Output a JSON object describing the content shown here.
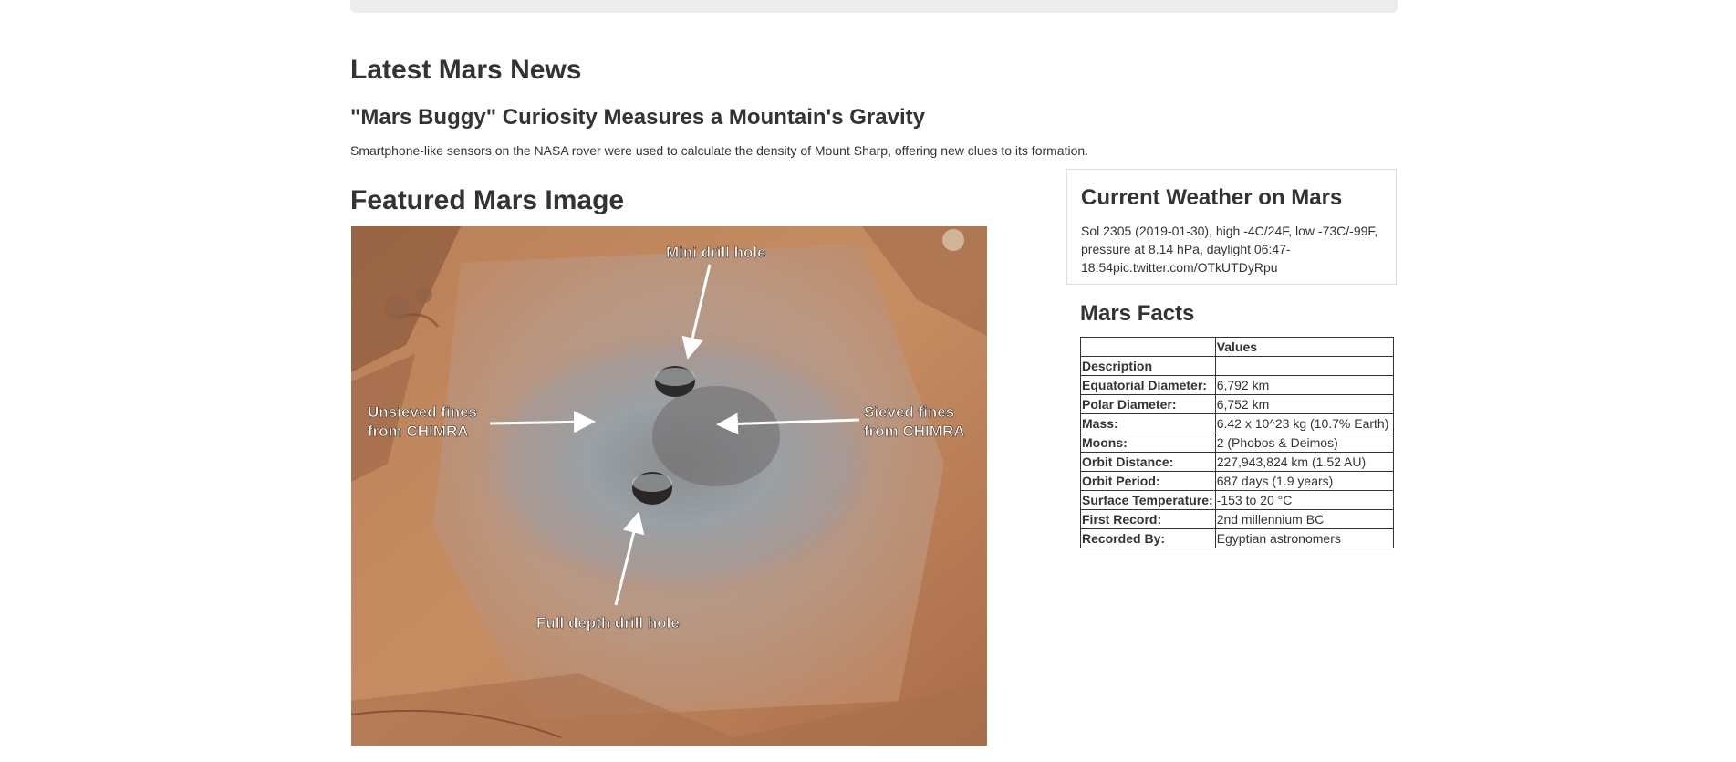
{
  "news": {
    "section_title": "Latest Mars News",
    "title": "\"Mars Buggy\" Curiosity Measures a Mountain's Gravity",
    "paragraph": "Smartphone-like sensors on the NASA rover were used to calculate the density of Mount Sharp, offering new clues to its formation."
  },
  "featured": {
    "title": "Featured Mars Image",
    "labels": {
      "mini_drill": "Mini drill hole",
      "unsieved_line1": "Unsieved fines",
      "unsieved_line2": "from CHIMRA",
      "sieved_line1": "Sieved fines",
      "sieved_line2": "from CHIMRA",
      "full_drill": "Full depth drill hole"
    }
  },
  "weather": {
    "title": "Current Weather on Mars",
    "text": "Sol 2305 (2019-01-30), high -4C/24F, low -73C/-99F, pressure at 8.14 hPa, daylight 06:47-18:54pic.twitter.com/OTkUTDyRpu"
  },
  "facts": {
    "title": "Mars Facts",
    "header": {
      "label": "",
      "value": "Values"
    },
    "index_label": "Description",
    "rows": [
      {
        "label": "Equatorial Diameter:",
        "value": "6,792 km"
      },
      {
        "label": "Polar Diameter:",
        "value": "6,752 km"
      },
      {
        "label": "Mass:",
        "value": "6.42 x 10^23 kg (10.7% Earth)"
      },
      {
        "label": "Moons:",
        "value": "2 (Phobos & Deimos)"
      },
      {
        "label": "Orbit Distance:",
        "value": "227,943,824 km (1.52 AU)"
      },
      {
        "label": "Orbit Period:",
        "value": "687 days (1.9 years)"
      },
      {
        "label": "Surface Temperature:",
        "value": "-153 to 20 °C"
      },
      {
        "label": "First Record:",
        "value": "2nd millennium BC"
      },
      {
        "label": "Recorded By:",
        "value": "Egyptian astronomers"
      }
    ]
  }
}
